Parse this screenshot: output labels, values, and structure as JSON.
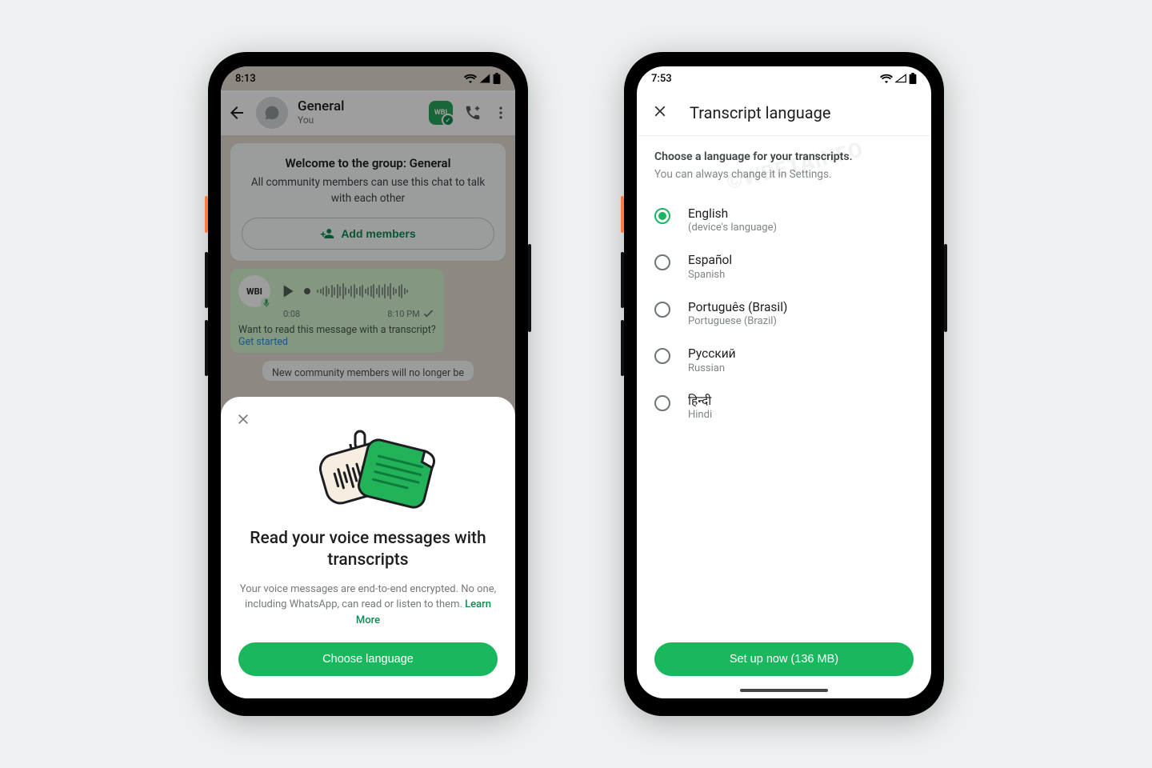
{
  "left": {
    "status_time": "8:13",
    "chat": {
      "title": "General",
      "subtitle": "You",
      "welcome_title": "Welcome to the group: General",
      "welcome_body": "All community members can use this chat to talk with each other",
      "add_members": "Add members",
      "wbi": "WBI",
      "voice_duration": "0:08",
      "voice_time": "8:10 PM",
      "transcript_prompt": "Want to read this message with a transcript?",
      "get_started": "Get started",
      "note": "New community members will no longer be",
      "wabeta": "WBI"
    },
    "sheet": {
      "title": "Read your voice messages with transcripts",
      "body": "Your voice messages are end-to-end encrypted. No one, including WhatsApp, can read or listen to them. ",
      "learn_more": "Learn More",
      "cta": "Choose language"
    }
  },
  "right": {
    "status_time": "7:53",
    "title": "Transcript language",
    "lead": "Choose a language for your transcripts.",
    "sub": "You can always change it in Settings.",
    "languages": [
      {
        "name": "English",
        "sub": "(device's language)",
        "checked": true
      },
      {
        "name": "Español",
        "sub": "Spanish",
        "checked": false
      },
      {
        "name": "Português (Brasil)",
        "sub": "Portuguese (Brazil)",
        "checked": false
      },
      {
        "name": "Русский",
        "sub": "Russian",
        "checked": false
      },
      {
        "name": "हिन्दी",
        "sub": "Hindi",
        "checked": false
      }
    ],
    "cta": "Set up now (136 MB)"
  },
  "watermark": "©WBETAINFO"
}
